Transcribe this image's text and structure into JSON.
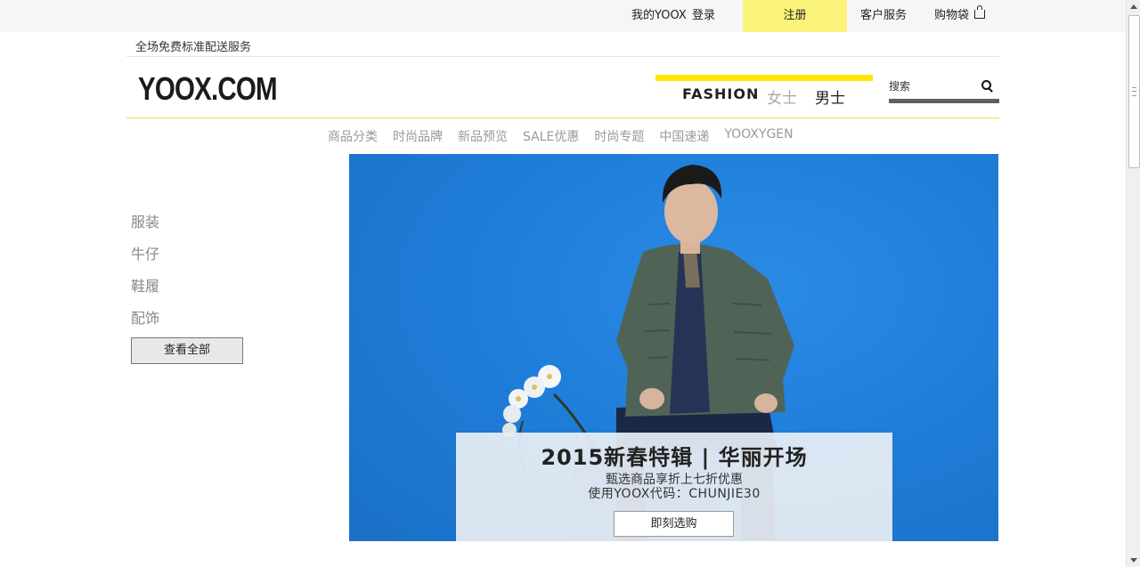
{
  "topbar": {
    "my_yoox": "我的YOOX",
    "login": "登录",
    "register": "注册",
    "customer_service": "客户服务",
    "shopping_bag": "购物袋"
  },
  "header": {
    "promo": "全场免费标准配送服务",
    "logo": "YOOX.COM",
    "fashion": "FASHION",
    "women": "女士",
    "men": "男士",
    "search_placeholder": "搜索",
    "accent_color": "#ffe600"
  },
  "catnav": [
    "商品分类",
    "时尚品牌",
    "新品预览",
    "SALE优惠",
    "时尚专题",
    "中国速递",
    "YOOXYGEN"
  ],
  "sidebar": {
    "items": [
      "服装",
      "牛仔",
      "鞋履",
      "配饰"
    ],
    "view_all": "查看全部"
  },
  "hero": {
    "title": "2015新春特辑 | 华丽开场",
    "line1": "甄选商品享折上七折优惠",
    "line2": "使用YOOX代码：CHUNJIE30",
    "button": "即刻选购",
    "background_color": "#1f7ed9"
  }
}
